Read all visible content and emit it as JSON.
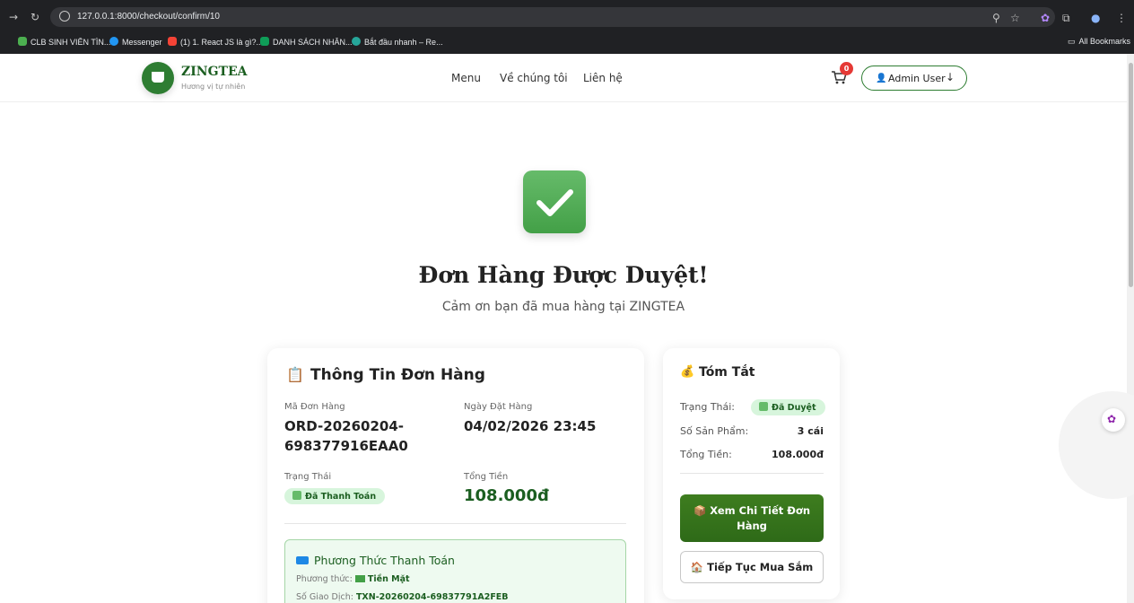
{
  "browser": {
    "url": "127.0.0.1:8000/checkout/confirm/10",
    "bookmarks": [
      {
        "label": "CLB SINH VIÊN TÌN...",
        "color": "#4caf50"
      },
      {
        "label": "Messenger",
        "color": "#2196f3"
      },
      {
        "label": "(1) 1. React JS là gì?...",
        "color": "#f44336"
      },
      {
        "label": "DANH SÁCH NHÂN...",
        "color": "#0f9d58"
      },
      {
        "label": "Bắt đầu nhanh – Re...",
        "color": "#26a69a"
      }
    ],
    "all_bookmarks": "All Bookmarks"
  },
  "header": {
    "brand": "ZINGTEA",
    "tagline": "Hương vị tự nhiên",
    "nav": [
      "Menu",
      "Về chúng tôi",
      "Liên hệ"
    ],
    "cart_count": "0",
    "user_label": "Admin User",
    "accent": "#2e7d32"
  },
  "hero": {
    "title": "Đơn Hàng Được Duyệt!",
    "subtitle": "Cảm ơn bạn đã mua hàng tại ZINGTEA"
  },
  "order": {
    "title": "Thông Tin Đơn Hàng",
    "code_label": "Mã Đơn Hàng",
    "code_line1": "ORD-20260204-",
    "code_line2": "698377916EAA0",
    "date_label": "Ngày Đặt Hàng",
    "date": "04/02/2026 23:45",
    "status_label": "Trạng Thái",
    "status": "Đã Thanh Toán",
    "total_label": "Tổng Tiền",
    "total": "108.000đ",
    "payment": {
      "title": "Phương Thức Thanh Toán",
      "method_label": "Phương thức:",
      "method": "Tiền Mặt",
      "txn_label": "Số Giao Dịch:",
      "txn": "TXN-20260204-69837791A2FEB"
    }
  },
  "summary": {
    "title": "Tóm Tắt",
    "status_label": "Trạng Thái:",
    "status": "Đã Duyệt",
    "count_label": "Số Sản Phẩm:",
    "count": "3 cái",
    "total_label": "Tổng Tiền:",
    "total": "108.000đ",
    "detail_btn_line1": "Xem Chi Tiết Đơn",
    "detail_btn_line2": "Hàng",
    "continue_btn": "Tiếp Tục Mua Sắm"
  }
}
